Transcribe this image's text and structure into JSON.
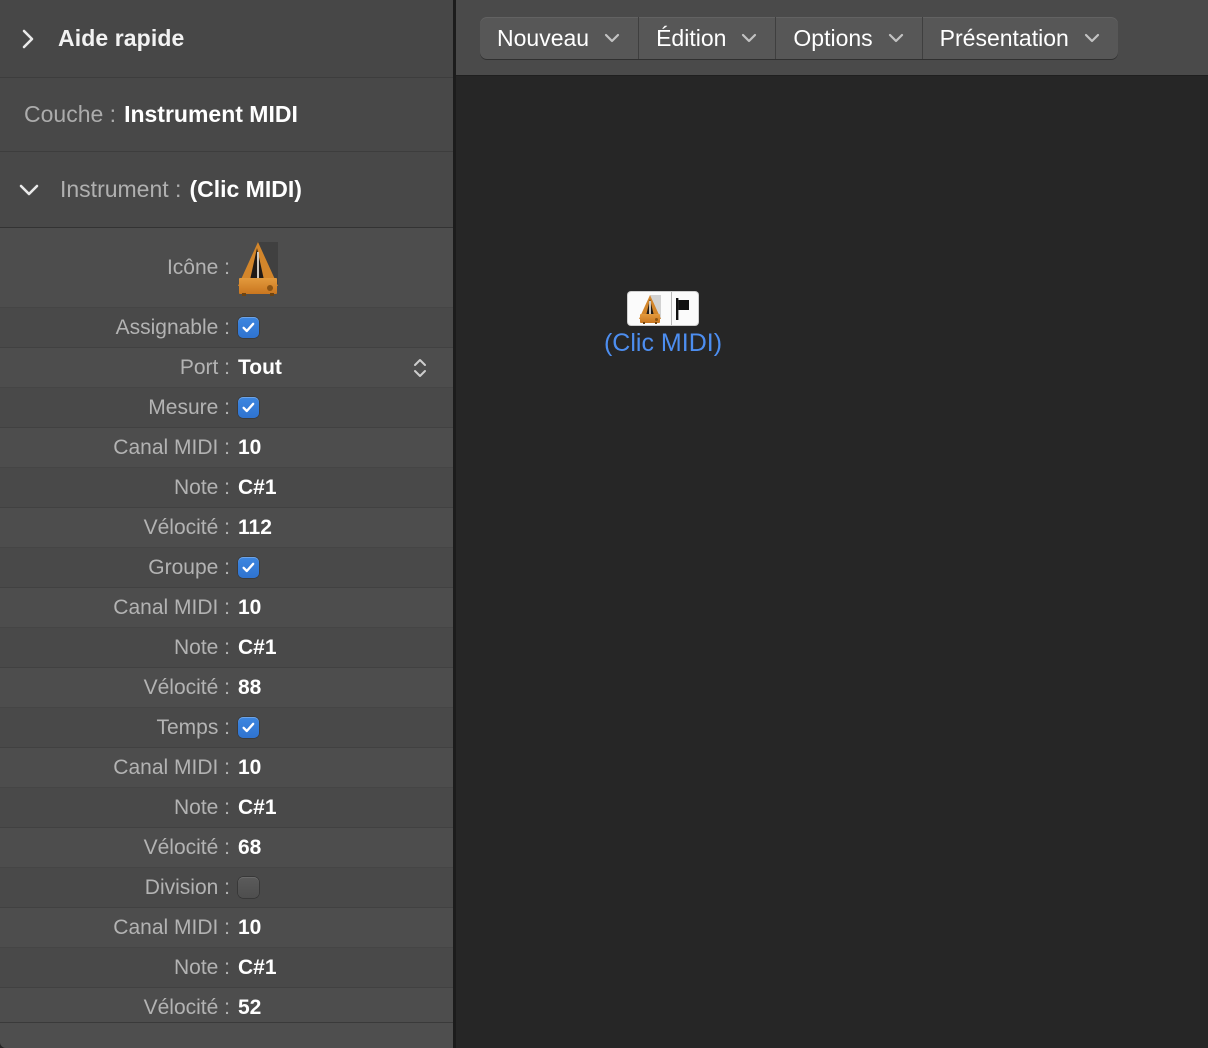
{
  "sidebar": {
    "quick_help": {
      "label": "Aide rapide",
      "disclosure_icon": "chevron-right-icon",
      "expanded": false
    },
    "layer": {
      "label": "Couche :",
      "value": "Instrument MIDI"
    },
    "instrument_section": {
      "label": "Instrument :",
      "value": "(Clic MIDI)",
      "disclosure_icon": "chevron-down-icon",
      "expanded": true
    },
    "parameters": [
      {
        "label": "Icône :",
        "type": "icon",
        "icon": "metronome-icon",
        "name": "icon-row"
      },
      {
        "label": "Assignable :",
        "type": "checkbox",
        "checked": true,
        "name": "assignable-row"
      },
      {
        "label": "Port :",
        "type": "select",
        "value": "Tout",
        "stepper_icon": "chevron-up-down-icon",
        "name": "port-row"
      },
      {
        "label": "Mesure :",
        "type": "checkbox",
        "checked": true,
        "name": "mesure-row"
      },
      {
        "label": "Canal MIDI :",
        "type": "text",
        "value": "10",
        "name": "canal-midi-row-1"
      },
      {
        "label": "Note :",
        "type": "text",
        "value": "C#1",
        "name": "note-row-1"
      },
      {
        "label": "Vélocité :",
        "type": "text",
        "value": "112",
        "name": "velocite-row-1"
      },
      {
        "label": "Groupe :",
        "type": "checkbox",
        "checked": true,
        "name": "groupe-row"
      },
      {
        "label": "Canal MIDI :",
        "type": "text",
        "value": "10",
        "name": "canal-midi-row-2"
      },
      {
        "label": "Note :",
        "type": "text",
        "value": "C#1",
        "name": "note-row-2"
      },
      {
        "label": "Vélocité :",
        "type": "text",
        "value": "88",
        "name": "velocite-row-2"
      },
      {
        "label": "Temps :",
        "type": "checkbox",
        "checked": true,
        "name": "temps-row"
      },
      {
        "label": "Canal MIDI :",
        "type": "text",
        "value": "10",
        "name": "canal-midi-row-3"
      },
      {
        "label": "Note :",
        "type": "text",
        "value": "C#1",
        "name": "note-row-3"
      },
      {
        "label": "Vélocité :",
        "type": "text",
        "value": "68",
        "name": "velocite-row-3"
      },
      {
        "label": "Division :",
        "type": "checkbox",
        "checked": false,
        "name": "division-row"
      },
      {
        "label": "Canal MIDI :",
        "type": "text",
        "value": "10",
        "name": "canal-midi-row-4"
      },
      {
        "label": "Note :",
        "type": "text",
        "value": "C#1",
        "name": "note-row-4"
      },
      {
        "label": "Vélocité :",
        "type": "text",
        "value": "52",
        "name": "velocite-row-4"
      }
    ]
  },
  "toolbar": {
    "buttons": [
      {
        "label": "Nouveau",
        "chevron_icon": "chevron-down-icon",
        "name": "menu-nouveau"
      },
      {
        "label": "Édition",
        "chevron_icon": "chevron-down-icon",
        "name": "menu-edition"
      },
      {
        "label": "Options",
        "chevron_icon": "chevron-down-icon",
        "name": "menu-options"
      },
      {
        "label": "Présentation",
        "chevron_icon": "chevron-down-icon",
        "name": "menu-presentation"
      }
    ]
  },
  "canvas": {
    "object": {
      "label": "(Clic MIDI)",
      "icon": "metronome-icon",
      "port_icon": "midi-output-flag-icon",
      "selected": true
    }
  },
  "colors": {
    "sidebar_bg": "#4b4b4b",
    "row_alt": "#4d4d4d",
    "row_base": "#494949",
    "canvas_bg": "#262626",
    "toolbar_bg": "#4a4a4a",
    "segment_bg": "#575757",
    "checkbox_on": "#3478d8",
    "checkbox_off": "#555555",
    "label_dim": "#b3b3b3",
    "value_text": "#ffffff",
    "object_label": "#4d8ef0",
    "divider": "#1c1c1c"
  }
}
